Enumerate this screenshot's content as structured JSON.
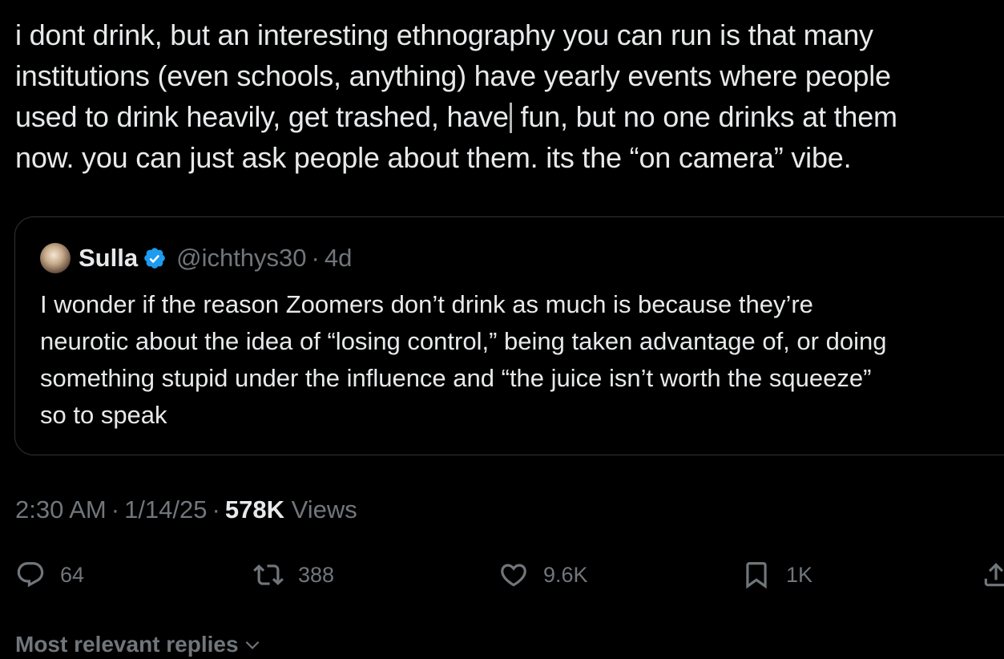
{
  "tweet": {
    "text_lines": [
      "i dont drink, but an interesting ethnography you can run is that many",
      "institutions (even schools, anything) have yearly events where people",
      "used to drink heavily, get trashed, have",
      " fun, but no one drinks at them",
      "now. you can just ask people about them. its the “on camera” vibe."
    ]
  },
  "quote": {
    "name": "Sulla",
    "handle": "@ichthys30",
    "separator": "·",
    "time": "4d",
    "text_lines": [
      "I wonder if the reason Zoomers don’t drink as much is because they’re",
      "neurotic about the idea of “losing control,” being taken advantage of, or doing",
      "something stupid under the influence and “the juice isn’t worth the squeeze”",
      "so to speak"
    ],
    "verified_color": "#1d9bf0"
  },
  "meta": {
    "time": "2:30 AM",
    "sep": "·",
    "date": "1/14/25",
    "views_count": "578K",
    "views_label": "Views"
  },
  "actions": {
    "reply_icon": "reply-icon",
    "reply_count": "64",
    "repost_icon": "repost-icon",
    "repost_count": "388",
    "like_icon": "heart-icon",
    "like_count": "9.6K",
    "bookmark_icon": "bookmark-icon",
    "bookmark_count": "1K",
    "share_icon": "share-icon"
  },
  "replies": {
    "sort_label": "Most relevant replies"
  },
  "colors": {
    "background": "#000000",
    "text": "#e7e9ea",
    "secondary": "#71767b",
    "border": "#2f3336",
    "verified": "#1d9bf0"
  }
}
